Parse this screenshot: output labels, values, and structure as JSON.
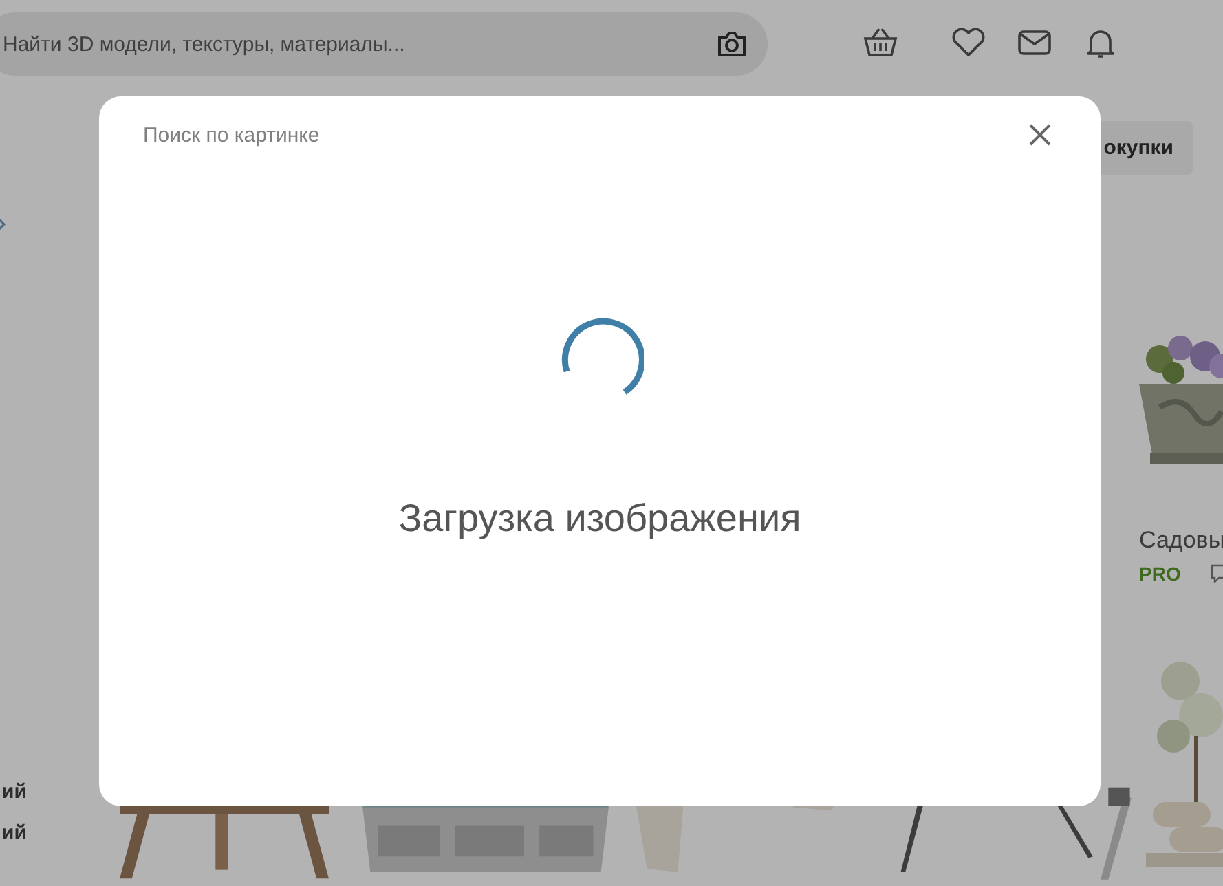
{
  "header": {
    "search": {
      "placeholder": "Найти 3D модели, текстуры, материалы..."
    }
  },
  "sidebar": {
    "items": [
      "ий",
      "ий"
    ]
  },
  "purchases_button": "окупки",
  "products": [
    {
      "title": "Садовы",
      "badge": "PRO"
    }
  ],
  "modal": {
    "title": "Поиск по картинке",
    "message": "Загрузка изображения"
  }
}
